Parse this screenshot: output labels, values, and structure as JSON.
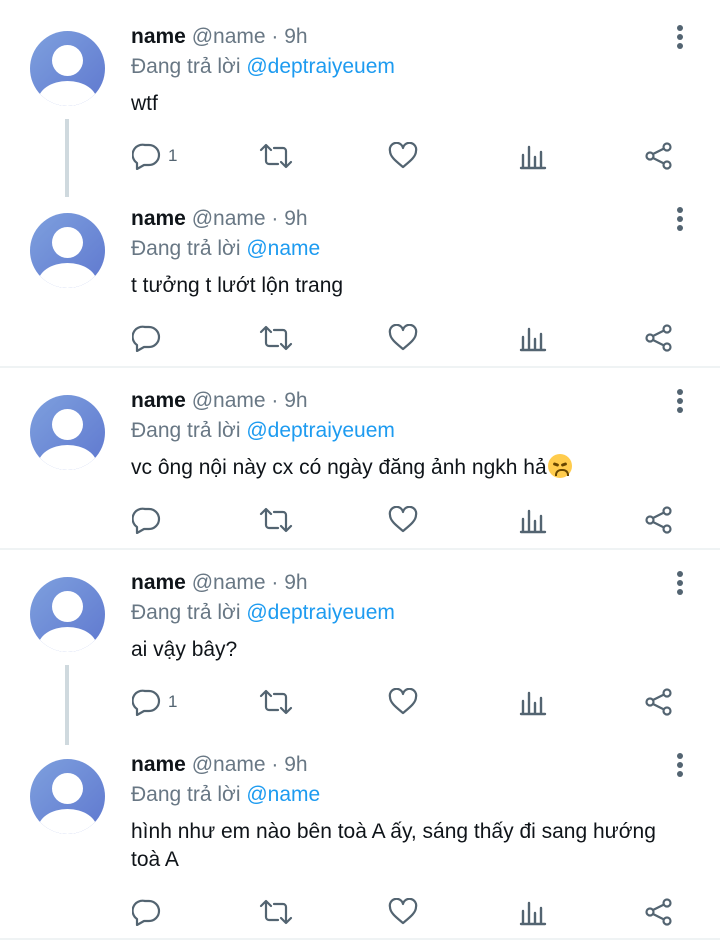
{
  "tweets": [
    {
      "name": "name",
      "meta": "@name · 9h",
      "reply_prefix": "Đang trả lời",
      "mention": "@deptraiyeuem",
      "text": "wtf",
      "reply_count": "1"
    },
    {
      "name": "name",
      "meta": "@name · 9h",
      "reply_prefix": "Đang trả lời",
      "mention": "@name",
      "text": "t tưởng t lướt lộn trang",
      "reply_count": ""
    },
    {
      "name": "name",
      "meta": "@name · 9h",
      "reply_prefix": "Đang trả lời",
      "mention": "@deptraiyeuem",
      "text": "vc ông nội này cx có ngày đăng ảnh ngkh hả",
      "emoji": "disappointed-face",
      "reply_count": ""
    },
    {
      "name": "name",
      "meta": "@name · 9h",
      "reply_prefix": "Đang trả lời",
      "mention": "@deptraiyeuem",
      "text": "ai vậy bây?",
      "reply_count": "1"
    },
    {
      "name": "name",
      "meta": "@name · 9h",
      "reply_prefix": "Đang trả lời",
      "mention": "@name",
      "text": "hình như em nào bên toà A ấy, sáng thấy đi sang hướng toà A",
      "reply_count": ""
    }
  ],
  "icons": {
    "reply": "reply-icon",
    "retweet": "retweet-icon",
    "like": "like-icon",
    "views": "views-icon",
    "share": "share-icon",
    "more": "more-icon"
  },
  "colors": {
    "mention": "#1d9bf0",
    "secondary_text": "#687784",
    "icon": "#536471",
    "thread_line": "#cfd9de"
  }
}
